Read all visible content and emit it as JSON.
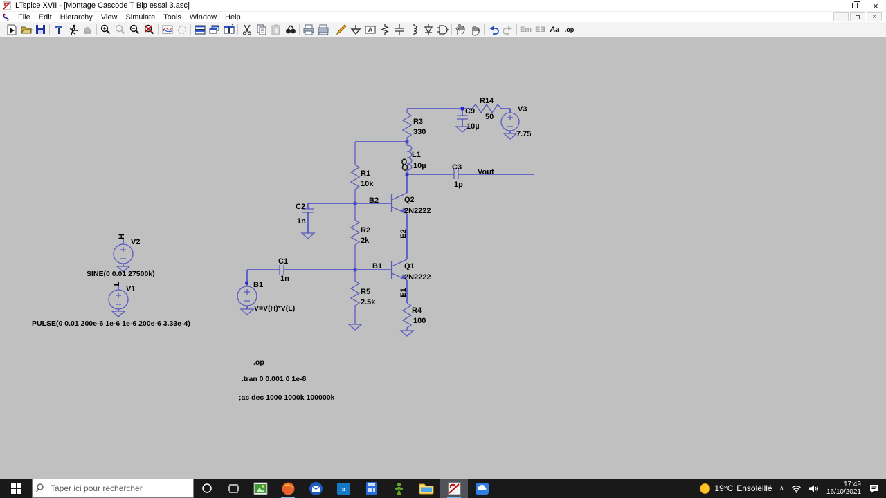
{
  "window": {
    "title": "LTspice XVII - [Montage Cascode T Bip essai 3.asc]"
  },
  "menubar": {
    "items": [
      "File",
      "Edit",
      "Hierarchy",
      "View",
      "Simulate",
      "Tools",
      "Window",
      "Help"
    ]
  },
  "toolbar": {
    "text_tool": "Aa",
    "directive_tool": ".op",
    "mirror_tool": "Em",
    "rotate_tool": "EƎ"
  },
  "schematic": {
    "labels": {
      "r14": "R14",
      "r14_val": "50",
      "c9": "C9",
      "c9_val": "10µ",
      "v3": "V3",
      "v3_val": "7.75",
      "r3": "R3",
      "r3_val": "330",
      "l1": "L1",
      "l1_val": "10µ",
      "c3": "C3",
      "c3_val": "1p",
      "vout": "Vout",
      "r1": "R1",
      "r1_val": "10k",
      "b2": "B2",
      "q2": "Q2",
      "q2_val": "2N2222",
      "c2": "C2",
      "c2_val": "1n",
      "r2": "R2",
      "r2_val": "2k",
      "e2": "E2",
      "c1": "C1",
      "c1_val": "1n",
      "b1_net": "B1",
      "q1": "Q1",
      "q1_val": "2N2222",
      "e1": "E1",
      "r5": "R5",
      "r5_val": "2.5k",
      "r4": "R4",
      "r4_val": "100",
      "b1_src": "B1",
      "b1_val": "V=V(H)*V(L)",
      "v2": "V2",
      "v2_val": "SINE(0 0.01 27500k)",
      "v1": "V1",
      "v1_val": "PULSE(0 0.01 200e-6 1e-6 1e-6 200e-6 3.33e-4)",
      "net_h": "H",
      "net_l": "L"
    },
    "directives": {
      "op": ".op",
      "tran": ".tran 0 0.001 0 1e-8",
      "ac": ";ac dec 1000 1000k 100000k"
    }
  },
  "taskbar": {
    "search_placeholder": "Taper ici pour rechercher",
    "weather": {
      "temp": "19°C",
      "desc": "Ensoleillé"
    },
    "clock": {
      "time": "17:49",
      "date": "16/10/2021"
    }
  },
  "colors": {
    "wire_blue": "#3030cc",
    "component_blue": "#5a5ac0",
    "canvas_gray": "#c0c0c0",
    "ltspice_red": "#c41212"
  }
}
